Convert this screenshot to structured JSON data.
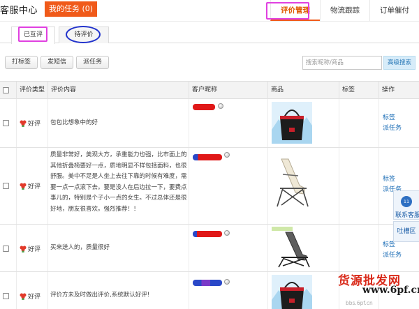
{
  "app": {
    "title": "客服中心"
  },
  "header": {
    "my_tasks": "我的任务 (0)",
    "tabs": [
      {
        "label": "评价管理",
        "active": true
      },
      {
        "label": "物流跟踪",
        "active": false
      },
      {
        "label": "订单催付",
        "active": false
      }
    ]
  },
  "subtabs": [
    {
      "label": "已互评",
      "active": true
    },
    {
      "label": "待评价",
      "active": false
    }
  ],
  "toolbar": {
    "buttons": [
      "打标签",
      "发短信",
      "派任务"
    ],
    "search_placeholder": "搜索昵称/商品",
    "advanced_search": "高级搜索"
  },
  "table": {
    "columns": [
      "评价类型",
      "评价内容",
      "客户昵称",
      "商品",
      "标签",
      "操作"
    ],
    "rows": [
      {
        "type": "好评",
        "content": "包包比想象中的好",
        "product_icon": "red-black-tote-bag",
        "actions": [
          "标签",
          "派任务"
        ]
      },
      {
        "type": "好评",
        "content": "质量非常好，美观大方，承重能力也强，比市面上的其他折叠椅要好一点，质地明显不样包括面料，也很舒服。美中不足是人坐上去往下靠的时候有难度，需要一点一点滚下去。要是没人在后边拉一下，要费点事儿的，特别是个子小一点的女生。不过总体还是很好地，朋友很喜欢。强烈推荐！！",
        "product_icon": "white-folding-chair",
        "actions": [
          "标签",
          "派任务"
        ]
      },
      {
        "type": "好评",
        "content": "买来送人的，质量很好",
        "product_icon": "gray-recliner-chair",
        "actions": [
          "标签",
          "派任务"
        ]
      },
      {
        "type": "好评",
        "content": "评价方未及时做出评价,系统默认好评!",
        "product_icon": "red-black-tote-bag",
        "actions": []
      }
    ]
  },
  "float": {
    "kefu_badge": "11",
    "kefu_label": "联系客服",
    "tucao_label": "吐槽区"
  },
  "watermark": {
    "line1": "货源批发网",
    "line2": "www.6pf.cn",
    "line3": "bbs.6pf.cn"
  },
  "colors": {
    "accent": "#f05a1a",
    "link": "#1e6fb7",
    "annotation_pink": "#e040e0",
    "annotation_blue": "#2233cc"
  }
}
